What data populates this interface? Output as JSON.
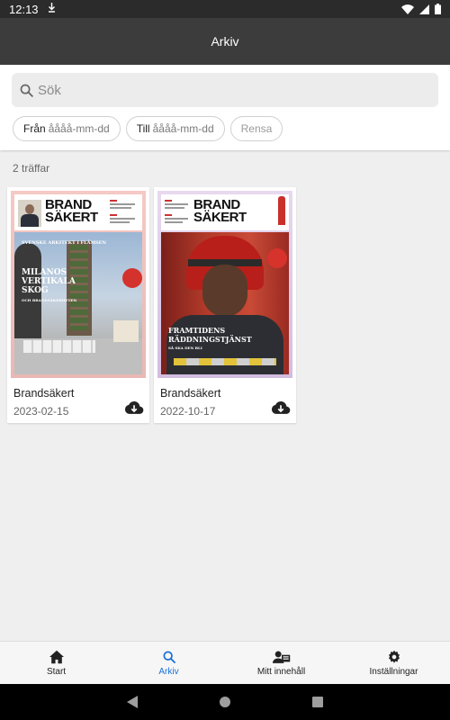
{
  "status": {
    "time": "12:13"
  },
  "app_bar": {
    "title": "Arkiv"
  },
  "search": {
    "placeholder": "Sök"
  },
  "filters": {
    "from_label": "Från",
    "from_placeholder": "åååå-mm-dd",
    "to_label": "Till",
    "to_placeholder": "åååå-mm-dd",
    "clear_label": "Rensa"
  },
  "results": {
    "count_text": "2 träffar"
  },
  "issues": [
    {
      "title": "Brandsäkert",
      "date": "2023-02-15",
      "cover": {
        "brand_top": "BRAND",
        "brand_bottom": "SÄKERT",
        "kicker": "SVENSKE ARKITEKT I FLÄMSEN",
        "headline": [
          "MILANOS",
          "VERTIKALA",
          "SKOG"
        ],
        "subline": "OCH BRANDSÄKERHETEN"
      }
    },
    {
      "title": "Brandsäkert",
      "date": "2022-10-17",
      "cover": {
        "brand_top": "BRAND",
        "brand_bottom": "SÄKERT",
        "headline": [
          "FRAMTIDENS",
          "RÄDDNINGSTJÄNST"
        ],
        "subline": "SÅ SKA DEN BLI"
      }
    }
  ],
  "bottom_nav": [
    {
      "label": "Start",
      "icon": "home-icon"
    },
    {
      "label": "Arkiv",
      "icon": "search-icon",
      "active": true
    },
    {
      "label": "Mitt innehåll",
      "icon": "profile-content-icon"
    },
    {
      "label": "Inställningar",
      "icon": "gear-icon"
    }
  ],
  "colors": {
    "accent": "#1a6fd6",
    "app_bar": "#3c3c3c",
    "status_bar": "#2b2b2b"
  }
}
